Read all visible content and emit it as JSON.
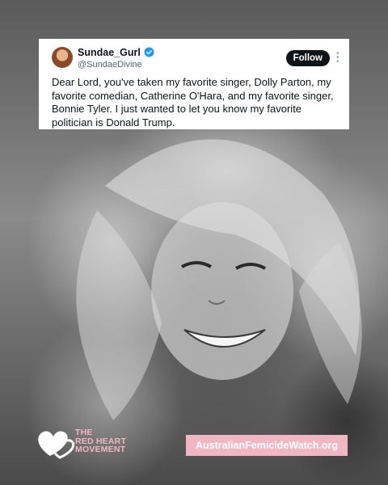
{
  "tweet": {
    "user_name": "Sundae_Gurl",
    "handle": "@SundaeDivine",
    "follow_label": "Follow",
    "text": "Dear Lord, you've taken my favorite singer, Dolly Parton, my favorite comedian, Catherine O'Hara, and my favorite singer, Bonnie Tyler. I just wanted to let you know my favorite politician is Donald Trump."
  },
  "footer": {
    "logo_line_1": "THE",
    "logo_line_2": "RED HEART",
    "logo_line_3": "MOVEMENT",
    "website": "AustralianFemicideWatch.org"
  },
  "colors": {
    "accent_pink": "#f0b6c4",
    "verified_blue": "#1d9bf0",
    "follow_button": "#0f1419"
  },
  "icons": {
    "verified": "verified-badge-icon",
    "more": "more-icon",
    "logo": "heart-logo-icon"
  }
}
